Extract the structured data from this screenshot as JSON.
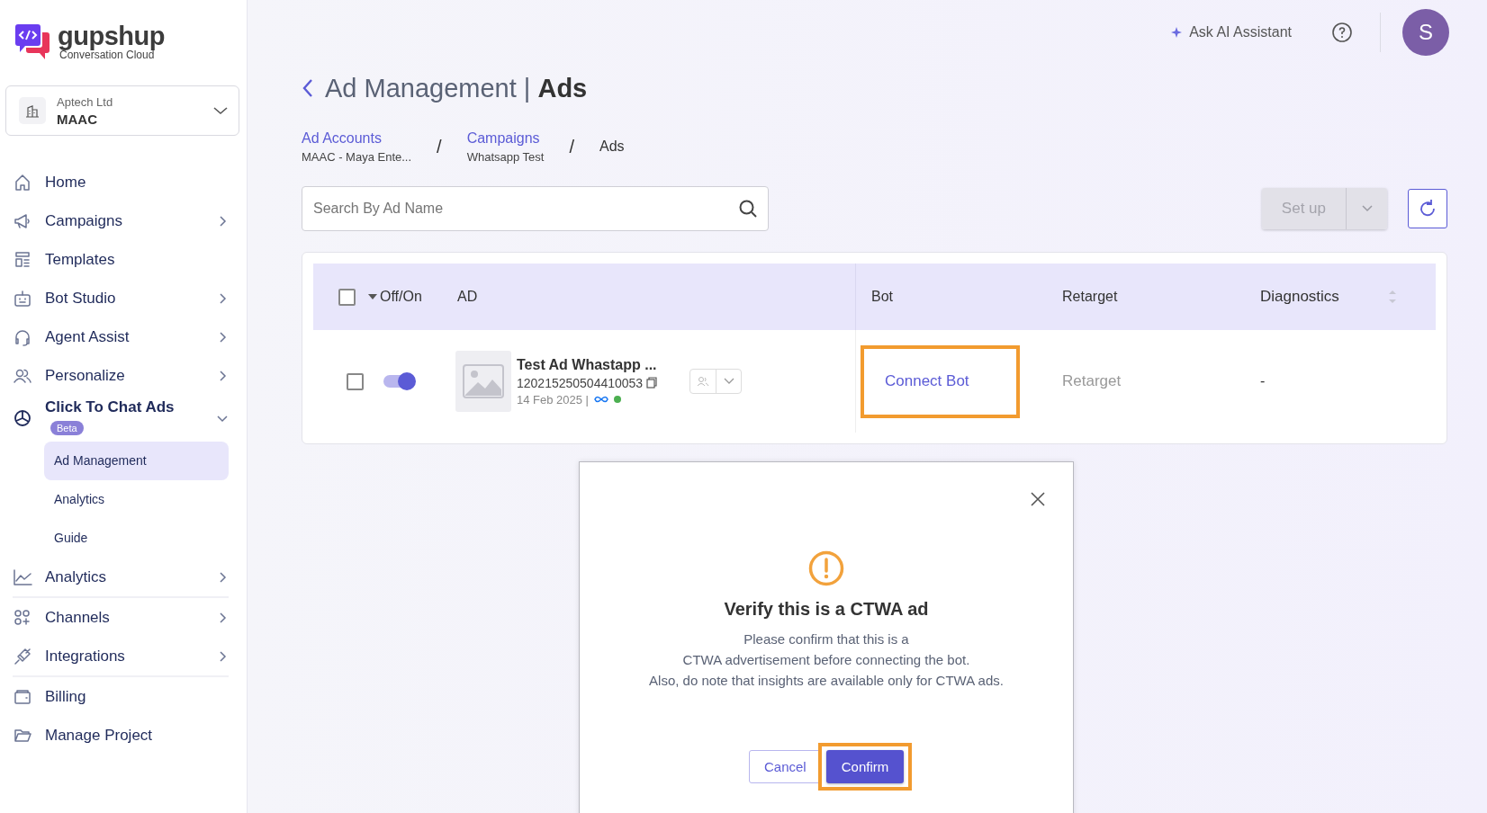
{
  "sidebar": {
    "logo": {
      "name": "gupshup",
      "tagline": "Conversation Cloud"
    },
    "workspace": {
      "org": "Aptech Ltd",
      "project": "MAAC"
    },
    "sections": [
      {
        "items": [
          {
            "label": "Home",
            "expandable": false,
            "expanded": false
          },
          {
            "label": "Campaigns",
            "expandable": true,
            "expanded": false
          },
          {
            "label": "Templates",
            "expandable": false,
            "expanded": false
          },
          {
            "label": "Bot Studio",
            "expandable": true,
            "expanded": false
          },
          {
            "label": "Agent Assist",
            "expandable": true,
            "expanded": false
          },
          {
            "label": "Personalize",
            "expandable": true,
            "expanded": false
          },
          {
            "label": "Click To Chat Ads",
            "badge": "Beta",
            "expandable": true,
            "expanded": true,
            "children": [
              {
                "label": "Ad Management",
                "selected": true
              },
              {
                "label": "Analytics",
                "selected": false
              },
              {
                "label": "Guide",
                "selected": false
              }
            ]
          },
          {
            "label": "Analytics",
            "expandable": true,
            "expanded": false
          }
        ]
      },
      {
        "items": [
          {
            "label": "Channels",
            "expandable": true,
            "expanded": false
          },
          {
            "label": "Integrations",
            "expandable": true,
            "expanded": false
          }
        ]
      },
      {
        "items": [
          {
            "label": "Billing",
            "expandable": false,
            "expanded": false
          },
          {
            "label": "Manage Project",
            "expandable": false,
            "expanded": false
          }
        ]
      }
    ]
  },
  "header": {
    "ai_button": "Ask AI Assistant",
    "avatar": "S"
  },
  "page": {
    "title": "Ad Management | **Ads**"
  },
  "breadcrumbs": [
    {
      "label": "Ad Accounts",
      "sub": "MAAC - Maya Ente...",
      "link": true
    },
    {
      "separator_before": "/",
      "label": "Campaigns",
      "sub": "Whatsapp Test",
      "link": true
    },
    {
      "separator_before": "/",
      "label": "Ads",
      "link": false
    }
  ],
  "search": {
    "placeholder": "Search By Ad Name"
  },
  "setup_button": {
    "label": "Set up",
    "disabled": true
  },
  "table": {
    "select_all": {
      "checked": false
    },
    "columns": [
      {
        "label": "Off/On"
      },
      {
        "label": "AD"
      },
      {
        "label": "Bot"
      },
      {
        "label": "Retarget"
      },
      {
        "label": "Diagnostics",
        "sortable": true
      }
    ],
    "rows": [
      {
        "checked": false,
        "on": true,
        "ad_name": "Test Ad Whastapp ...",
        "ad_id": "120215250504410053",
        "date": "14 Feb 2025 |",
        "color": "#4caf50",
        "bot": "Connect Bot",
        "bot_highlighted": true,
        "retarget": "Retarget",
        "diagnostics": "-"
      }
    ]
  },
  "dialog": {
    "title": "Verify this is a CTWA ad",
    "message_lines": [
      "Please confirm that this is a",
      "CTWA advertisement before connecting the bot.",
      "Also, do note that insights are available only for CTWA ads."
    ],
    "buttons": [
      {
        "label": "Cancel",
        "kind": "secondary",
        "highlighted": false
      },
      {
        "label": "Confirm",
        "kind": "primary",
        "highlighted": true
      }
    ]
  }
}
